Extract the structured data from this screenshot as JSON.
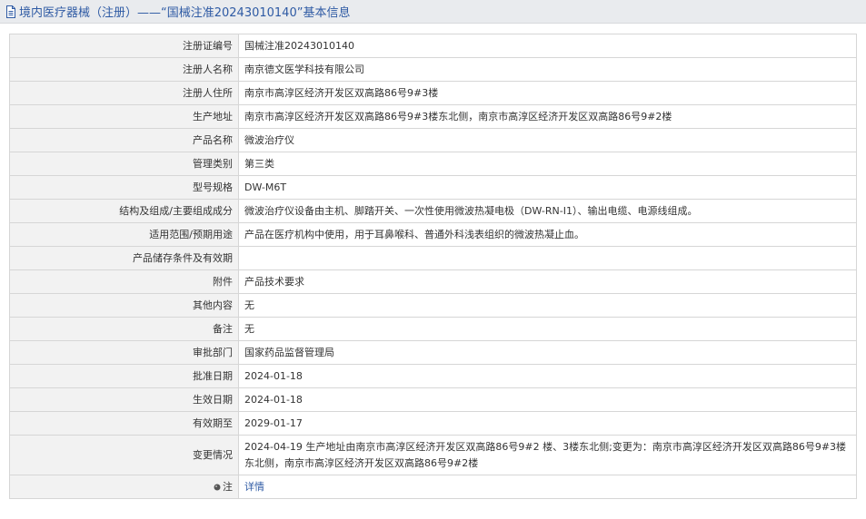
{
  "header": {
    "title": "境内医疗器械（注册）——“国械注准20243010140”基本信息",
    "icon": "document-icon"
  },
  "rows": [
    {
      "label": "注册证编号",
      "value": "国械注准20243010140"
    },
    {
      "label": "注册人名称",
      "value": "南京德文医学科技有限公司"
    },
    {
      "label": "注册人住所",
      "value": "南京市高淳区经济开发区双高路86号9#3楼"
    },
    {
      "label": "生产地址",
      "value": "南京市高淳区经济开发区双高路86号9#3楼东北侧，南京市高淳区经济开发区双高路86号9#2楼"
    },
    {
      "label": "产品名称",
      "value": "微波治疗仪"
    },
    {
      "label": "管理类别",
      "value": "第三类"
    },
    {
      "label": "型号规格",
      "value": "DW-M6T"
    },
    {
      "label": "结构及组成/主要组成成分",
      "value": "微波治疗仪设备由主机、脚踏开关、一次性使用微波热凝电极（DW-RN-I1）、输出电缆、电源线组成。"
    },
    {
      "label": "适用范围/预期用途",
      "value": "产品在医疗机构中使用，用于耳鼻喉科、普通外科浅表组织的微波热凝止血。"
    },
    {
      "label": "产品储存条件及有效期",
      "value": ""
    },
    {
      "label": "附件",
      "value": "产品技术要求"
    },
    {
      "label": "其他内容",
      "value": "无"
    },
    {
      "label": "备注",
      "value": "无"
    },
    {
      "label": "审批部门",
      "value": "国家药品监督管理局"
    },
    {
      "label": "批准日期",
      "value": "2024-01-18"
    },
    {
      "label": "生效日期",
      "value": "2024-01-18"
    },
    {
      "label": "有效期至",
      "value": "2029-01-17"
    },
    {
      "label": "变更情况",
      "value": "2024-04-19 生产地址由南京市高淳区经济开发区双高路86号9#2 楼、3楼东北侧;变更为：南京市高淳区经济开发区双高路86号9#3楼东北侧，南京市高淳区经济开发区双高路86号9#2楼"
    }
  ],
  "note_row": {
    "label": "注",
    "icon": "pin-icon",
    "link_text": "详情"
  },
  "colors": {
    "header_bg": "#e9ebee",
    "header_text": "#2e5aa4",
    "label_bg": "#f2f2f2",
    "border": "#d6d6d6",
    "link": "#2e5aa4"
  }
}
